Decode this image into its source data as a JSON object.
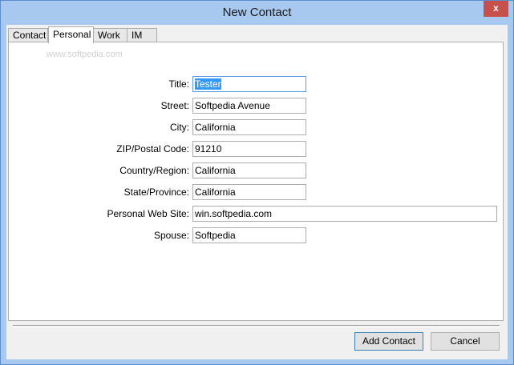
{
  "window": {
    "title": "New Contact",
    "close_glyph": "x"
  },
  "tabs": [
    {
      "label": "Contact",
      "active": false
    },
    {
      "label": "Personal",
      "active": true
    },
    {
      "label": "Work",
      "active": false
    },
    {
      "label": "IM",
      "active": false
    }
  ],
  "watermark": "www.softpedia.com",
  "form": {
    "title": {
      "label": "Title:",
      "value": "Tester"
    },
    "street": {
      "label": "Street:",
      "value": "Softpedia Avenue"
    },
    "city": {
      "label": "City:",
      "value": "California"
    },
    "zip": {
      "label": "ZIP/Postal Code:",
      "value": "91210"
    },
    "country": {
      "label": "Country/Region:",
      "value": "California"
    },
    "state": {
      "label": "State/Province:",
      "value": "California"
    },
    "website": {
      "label": "Personal Web Site:",
      "value": "win.softpedia.com"
    },
    "spouse": {
      "label": "Spouse:",
      "value": "Softpedia"
    }
  },
  "buttons": {
    "add_contact": "Add Contact",
    "cancel": "Cancel"
  },
  "colors": {
    "frame": "#a7c8ef",
    "close": "#c7504b",
    "selection": "#3399ff"
  }
}
